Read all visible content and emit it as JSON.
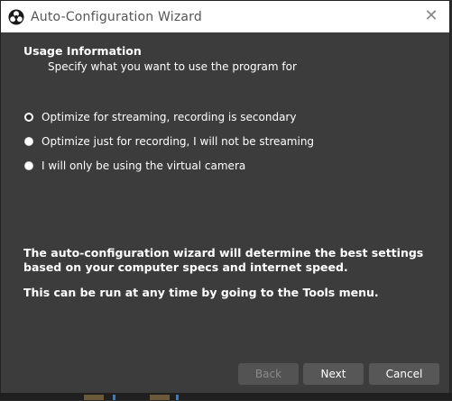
{
  "window": {
    "title": "Auto-Configuration Wizard",
    "close_icon": "close-icon"
  },
  "usage": {
    "heading": "Usage Information",
    "subheading": "Specify what you want to use the program for",
    "options": [
      {
        "label": "Optimize for streaming, recording is secondary",
        "selected": true
      },
      {
        "label": "Optimize just for recording, I will not be streaming",
        "selected": false
      },
      {
        "label": "I will only be using the virtual camera",
        "selected": false
      }
    ]
  },
  "info": {
    "paragraph1_line1": "The auto-configuration wizard will determine the best settings",
    "paragraph1_line2": "based on your computer specs and internet speed.",
    "paragraph2": "This can be run at any time by going to the Tools menu."
  },
  "buttons": {
    "back": "Back",
    "next": "Next",
    "cancel": "Cancel"
  },
  "colors": {
    "dialog_bg": "#3c3c3c",
    "titlebar_bg": "#ffffff",
    "button_bg": "#575757",
    "text": "#ffffff"
  }
}
